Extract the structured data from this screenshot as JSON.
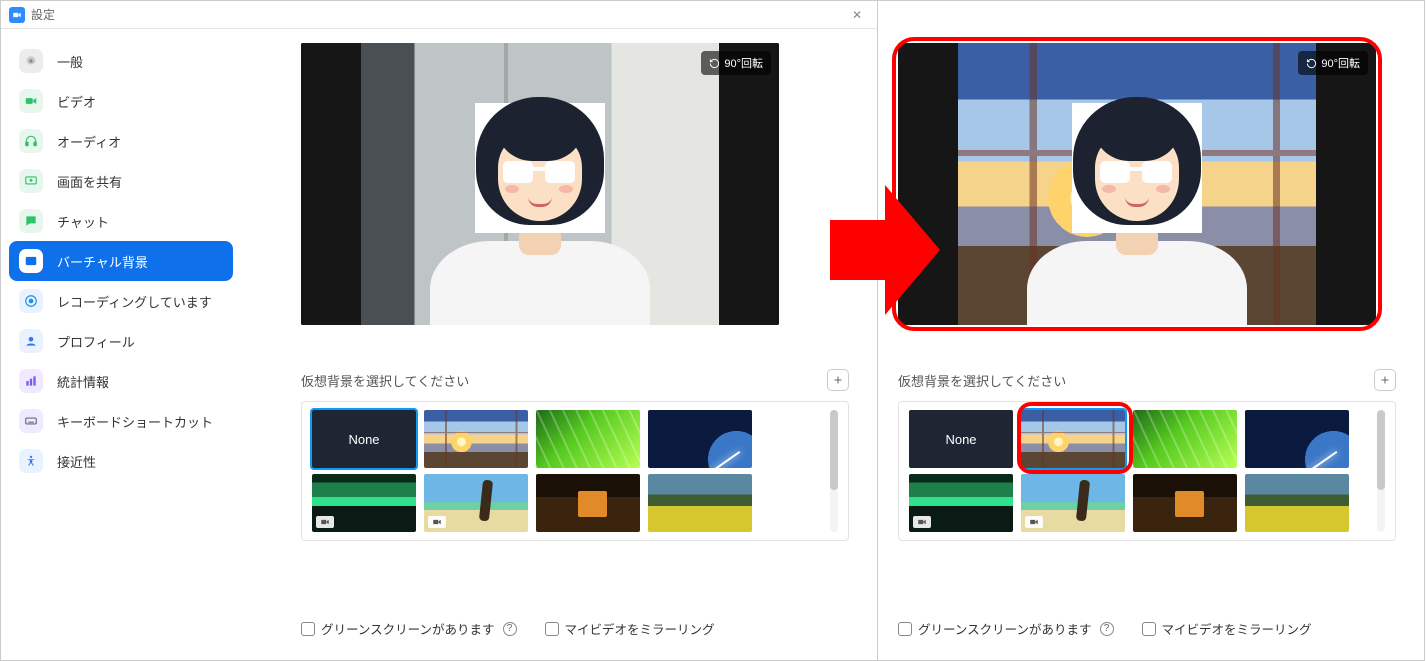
{
  "window": {
    "title": "設定",
    "close_glyph": "✕"
  },
  "sidebar": {
    "items": [
      {
        "label": "一般",
        "icon": "gear-icon",
        "bg": "#ededed",
        "fg": "#8a8a8a"
      },
      {
        "label": "ビデオ",
        "icon": "video-icon",
        "bg": "#e8f7ee",
        "fg": "#2fc26b"
      },
      {
        "label": "オーディオ",
        "icon": "headphones-icon",
        "bg": "#e8f7ee",
        "fg": "#2fc26b"
      },
      {
        "label": "画面を共有",
        "icon": "share-screen-icon",
        "bg": "#e8f7ee",
        "fg": "#2fc26b"
      },
      {
        "label": "チャット",
        "icon": "chat-icon",
        "bg": "#e8f7ee",
        "fg": "#2fc26b"
      },
      {
        "label": "バーチャル背景",
        "icon": "virtual-bg-icon",
        "bg": "#ffffff",
        "fg": "#0e71eb",
        "active": true
      },
      {
        "label": "レコーディングしています",
        "icon": "record-icon",
        "bg": "#e9f3ff",
        "fg": "#1f8fe6"
      },
      {
        "label": "プロフィール",
        "icon": "profile-icon",
        "bg": "#e9f3ff",
        "fg": "#3b78e7"
      },
      {
        "label": "統計情報",
        "icon": "stats-icon",
        "bg": "#efeaff",
        "fg": "#7a5af0"
      },
      {
        "label": "キーボードショートカット",
        "icon": "keyboard-icon",
        "bg": "#efeaff",
        "fg": "#6b6b7a"
      },
      {
        "label": "接近性",
        "icon": "accessibility-icon",
        "bg": "#e9f3ff",
        "fg": "#3b78e7"
      }
    ]
  },
  "preview": {
    "rotate_label": "90°回転"
  },
  "section": {
    "choose_bg_label": "仮想背景を選択してください"
  },
  "thumbs": {
    "none_label": "None",
    "items": [
      {
        "name": "none"
      },
      {
        "name": "golden-gate-sunset"
      },
      {
        "name": "grass"
      },
      {
        "name": "earth-from-space"
      },
      {
        "name": "aurora",
        "video": true
      },
      {
        "name": "beach",
        "video": true
      },
      {
        "name": "cabin-night"
      },
      {
        "name": "flower-field"
      }
    ],
    "selected_left": "none",
    "selected_right": "golden-gate-sunset"
  },
  "checks": {
    "green_screen": "グリーンスクリーンがあります",
    "mirror": "マイビデオをミラーリング"
  }
}
